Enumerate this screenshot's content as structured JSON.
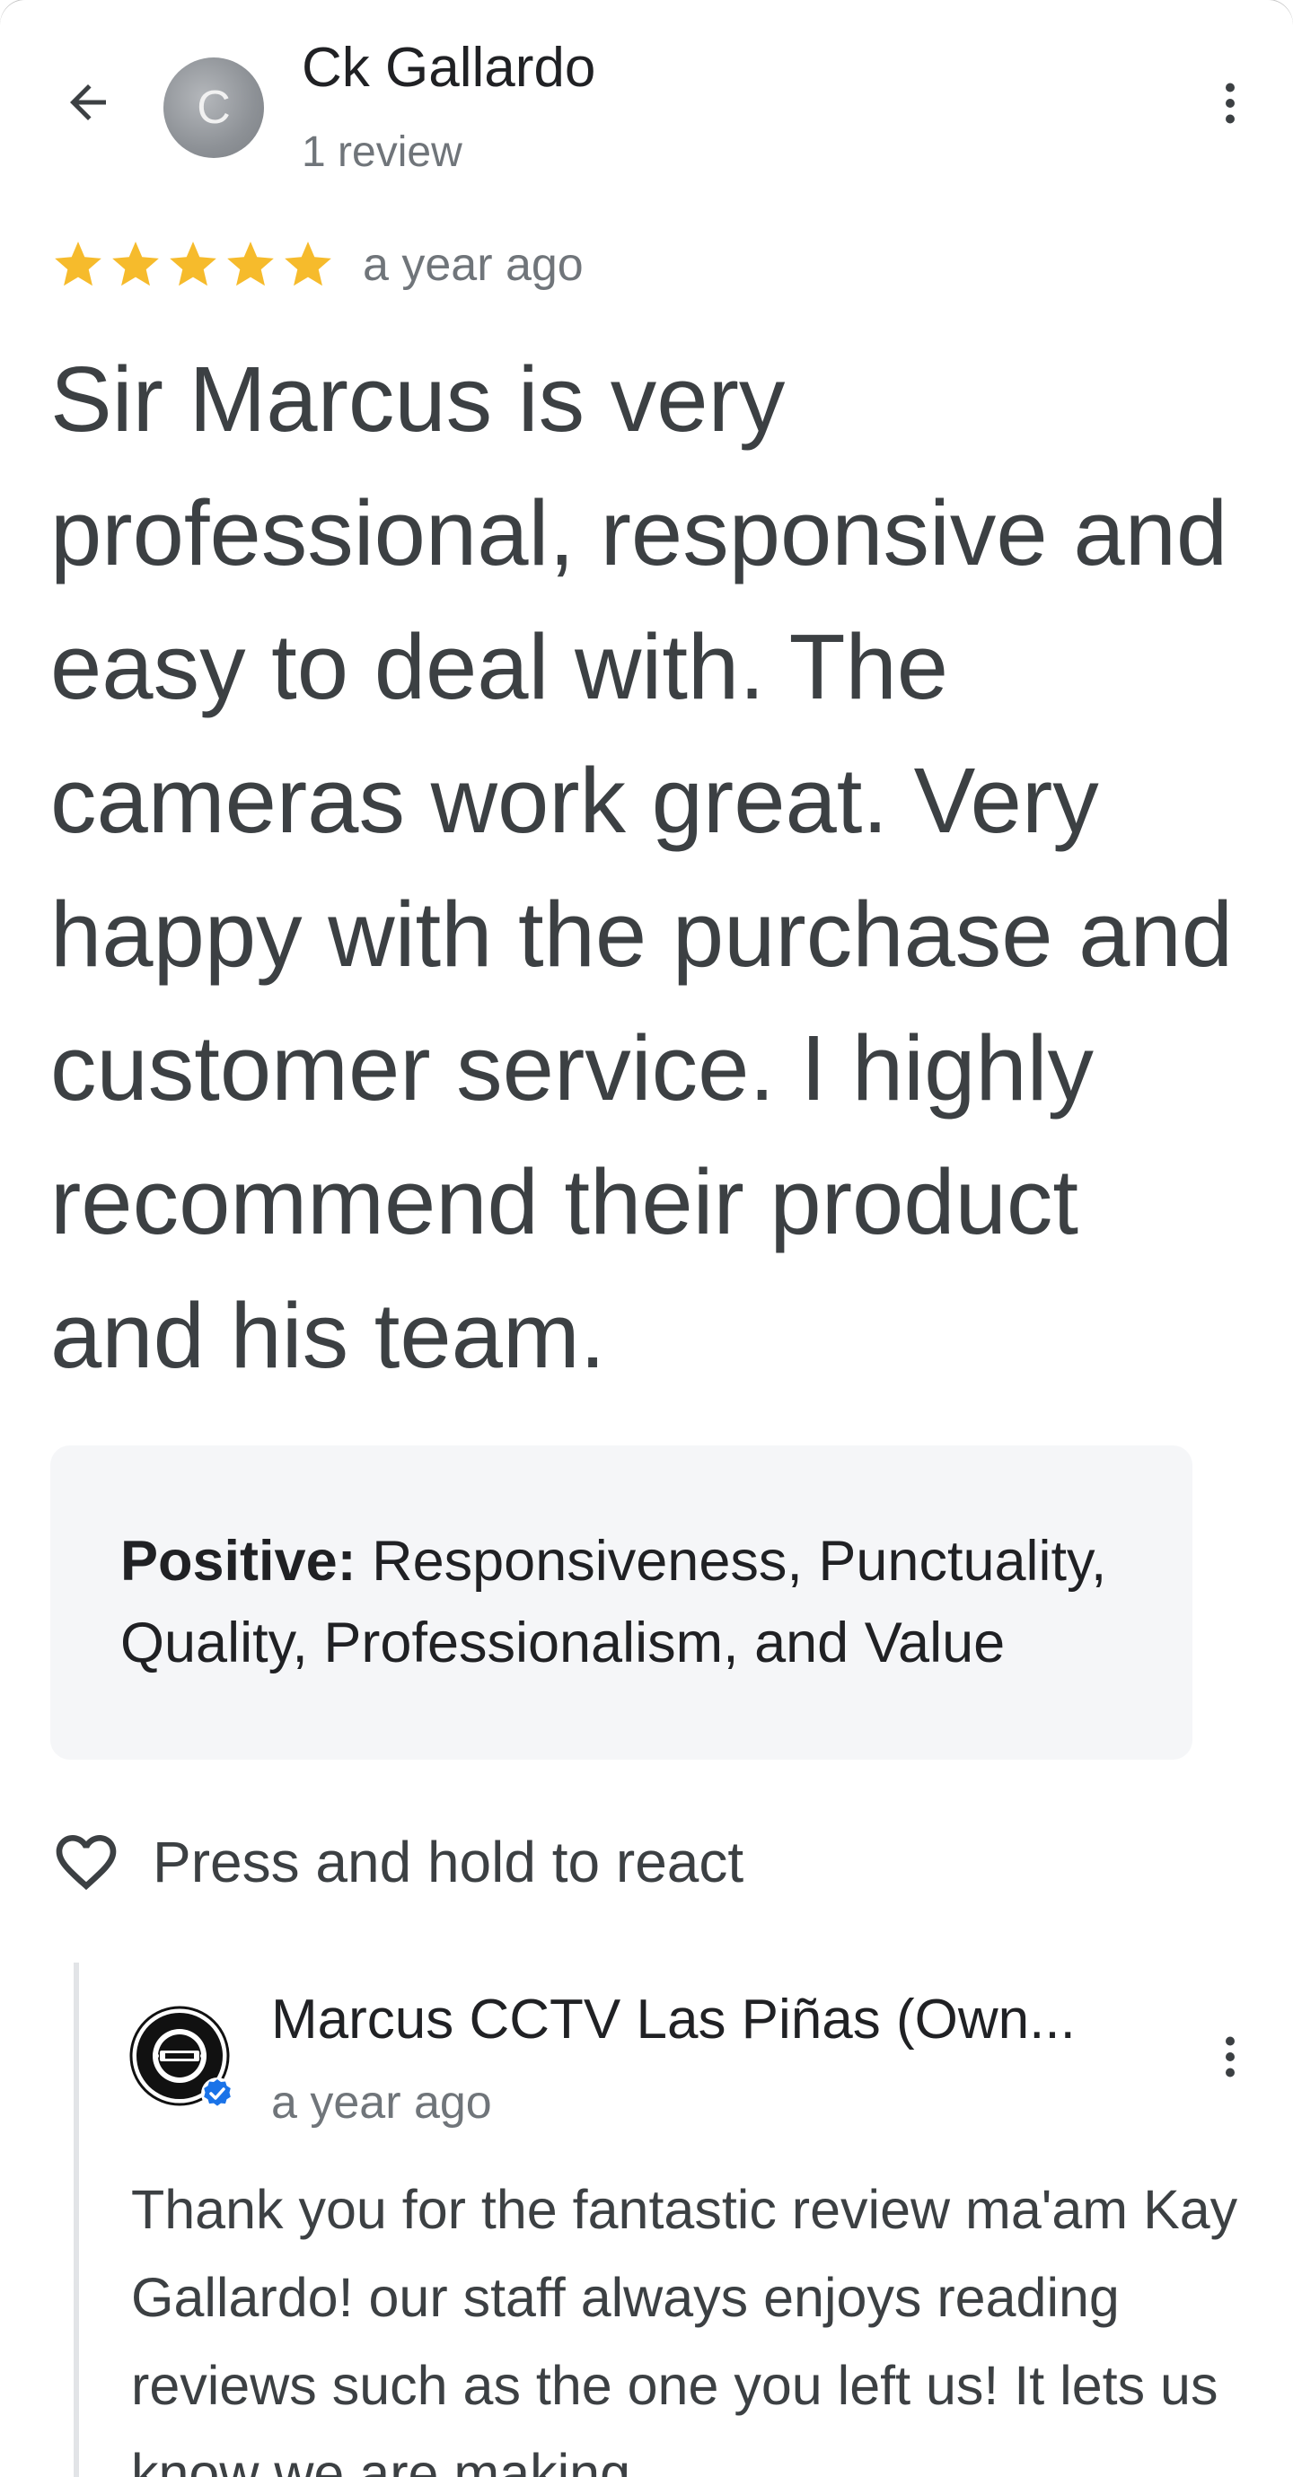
{
  "reviewer": {
    "avatar_initial": "C",
    "name": "Ck Gallardo",
    "review_count": "1 review"
  },
  "review": {
    "rating": 5,
    "max_rating": 5,
    "time": "a year ago",
    "text": "Sir Marcus is very professional, responsive and easy to deal with. The cameras work great. Very happy with the purchase and customer service. I highly recommend their product and his team.",
    "attributes_label": "Positive:",
    "attributes_value": "Responsiveness, Punctuality, Quality, Professionalism, and Value"
  },
  "react": {
    "label": "Press and hold to react"
  },
  "owner_reply": {
    "name": "Marcus CCTV Las Piñas (Own...",
    "time": "a year ago",
    "text": "Thank you for the fantastic review ma'am Kay Gallardo! our staff always enjoys reading reviews such as the one you left us! It lets us know we are making"
  },
  "icons": {
    "back": "arrow-left-icon",
    "more": "more-vert-icon",
    "star": "star-icon",
    "heart": "heart-outline-icon",
    "verified": "verified-badge-icon"
  },
  "colors": {
    "star": "#f6bb2c",
    "verified": "#1a73e8",
    "card_bg": "#f5f6f8",
    "text_secondary": "#70757a"
  }
}
